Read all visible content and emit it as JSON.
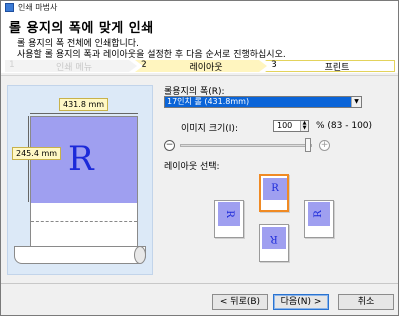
{
  "window": {
    "title": "인쇄 마법사"
  },
  "header": {
    "heading": "롤 용지의 폭에 맞게 인쇄",
    "desc1": "롤 용지의 폭 전체에 인쇄합니다.",
    "desc2": "사용할 롤 용지의 폭과 레이아웃을 설정한 후 다음 순서로 진행하십시오."
  },
  "steps": [
    {
      "num": "1",
      "label": "인쇄 메뉴"
    },
    {
      "num": "2",
      "label": "레이아웃"
    },
    {
      "num": "3",
      "label": "프린트"
    }
  ],
  "preview": {
    "width_label": "431.8 mm",
    "height_label": "245.4 mm",
    "sample_letter": "R"
  },
  "settings": {
    "roll_width_label": "롤용지의 폭(R):",
    "roll_width_value": "17인치 롤 (431.8mm)",
    "image_size_label": "이미지 크기(I):",
    "image_size_value": "100",
    "image_size_range": "% (83 - 100)",
    "zoom_out_symbol": "−",
    "zoom_in_symbol": "+",
    "layout_select_label": "레이아웃 선택:"
  },
  "buttons": {
    "back": "< 뒤로(B)",
    "next": "다음(N) >",
    "cancel": "취소"
  },
  "colors": {
    "accent_step": "#fff5bf",
    "print_area": "#9f9ff0",
    "sample_letter": "#1c2ad9",
    "layout_selected": "#f08a24",
    "combo_highlight": "#0a64d8"
  }
}
